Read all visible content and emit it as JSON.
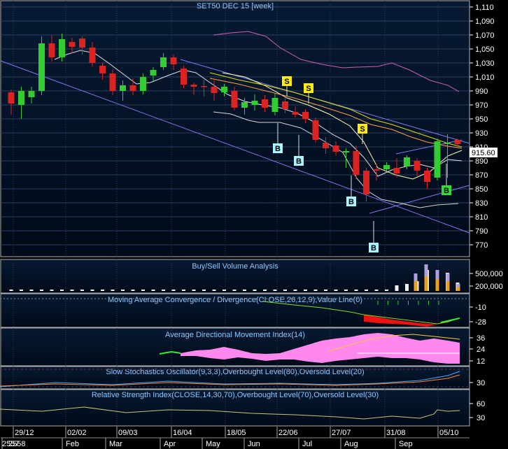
{
  "chart_data": [
    {
      "type": "candlestick",
      "title": "SET50 DEC 15   [week]",
      "y_ticks": [
        1110,
        1090,
        1070,
        1050,
        1030,
        1010,
        990,
        970,
        950,
        930,
        910,
        890,
        870,
        850,
        830,
        810,
        790,
        770
      ],
      "ylim": [
        758,
        1114
      ],
      "last_price": "915.60",
      "last_price_value": 915.6,
      "candles": [
        {
          "o": 988,
          "c": 972,
          "h": 992,
          "l": 956
        },
        {
          "o": 970,
          "c": 990,
          "h": 996,
          "l": 950
        },
        {
          "o": 981,
          "c": 990,
          "h": 996,
          "l": 972
        },
        {
          "o": 990,
          "c": 1058,
          "h": 1068,
          "l": 984
        },
        {
          "o": 1058,
          "c": 1038,
          "h": 1070,
          "l": 1032
        },
        {
          "o": 1038,
          "c": 1064,
          "h": 1072,
          "l": 1032
        },
        {
          "o": 1060,
          "c": 1053,
          "h": 1066,
          "l": 1044
        },
        {
          "o": 1065,
          "c": 1052,
          "h": 1068,
          "l": 1042
        },
        {
          "o": 1052,
          "c": 1030,
          "h": 1060,
          "l": 1025
        },
        {
          "o": 1026,
          "c": 1015,
          "h": 1030,
          "l": 1006
        },
        {
          "o": 1015,
          "c": 990,
          "h": 1020,
          "l": 984
        },
        {
          "o": 990,
          "c": 998,
          "h": 1005,
          "l": 976
        },
        {
          "o": 998,
          "c": 990,
          "h": 1008,
          "l": 984
        },
        {
          "o": 990,
          "c": 1010,
          "h": 1015,
          "l": 985
        },
        {
          "o": 1012,
          "c": 1020,
          "h": 1024,
          "l": 1004
        },
        {
          "o": 1024,
          "c": 1038,
          "h": 1044,
          "l": 1020
        },
        {
          "o": 1038,
          "c": 1028,
          "h": 1042,
          "l": 1020
        },
        {
          "o": 1022,
          "c": 999,
          "h": 1026,
          "l": 994
        },
        {
          "o": 999,
          "c": 996,
          "h": 1002,
          "l": 985
        },
        {
          "o": 997,
          "c": 996,
          "h": 1006,
          "l": 982
        },
        {
          "o": 996,
          "c": 987,
          "h": 1008,
          "l": 976
        },
        {
          "o": 988,
          "c": 996,
          "h": 1000,
          "l": 982
        },
        {
          "o": 990,
          "c": 966,
          "h": 996,
          "l": 962
        },
        {
          "o": 966,
          "c": 974,
          "h": 980,
          "l": 956
        },
        {
          "o": 970,
          "c": 976,
          "h": 985,
          "l": 962
        },
        {
          "o": 978,
          "c": 966,
          "h": 984,
          "l": 960
        },
        {
          "o": 960,
          "c": 980,
          "h": 986,
          "l": 955
        },
        {
          "o": 975,
          "c": 964,
          "h": 980,
          "l": 958
        },
        {
          "o": 960,
          "c": 956,
          "h": 968,
          "l": 952
        },
        {
          "o": 960,
          "c": 950,
          "h": 964,
          "l": 944
        },
        {
          "o": 948,
          "c": 920,
          "h": 952,
          "l": 916
        },
        {
          "o": 916,
          "c": 908,
          "h": 924,
          "l": 900
        },
        {
          "o": 912,
          "c": 903,
          "h": 918,
          "l": 898
        },
        {
          "o": 902,
          "c": 904,
          "h": 908,
          "l": 880
        },
        {
          "o": 904,
          "c": 870,
          "h": 912,
          "l": 864
        },
        {
          "o": 876,
          "c": 842,
          "h": 880,
          "l": 832
        },
        {
          "o": 878,
          "c": 876,
          "h": 886,
          "l": 862
        },
        {
          "o": 878,
          "c": 884,
          "h": 888,
          "l": 876
        },
        {
          "o": 880,
          "c": 872,
          "h": 894,
          "l": 866
        },
        {
          "o": 882,
          "c": 895,
          "h": 898,
          "l": 878
        },
        {
          "o": 890,
          "c": 876,
          "h": 894,
          "l": 868
        },
        {
          "o": 876,
          "c": 860,
          "h": 880,
          "l": 850
        },
        {
          "o": 866,
          "c": 918,
          "h": 922,
          "l": 862
        },
        {
          "o": 914,
          "c": 916,
          "h": 928,
          "l": 866
        },
        {
          "o": 920,
          "c": 914,
          "h": 922,
          "l": 910
        }
      ],
      "sell_signals": [
        "S",
        "S",
        "S"
      ],
      "buy_signals": [
        "B",
        "B",
        "B",
        "B",
        "B"
      ],
      "x_tick_labels": [
        "29/12",
        "02/02",
        "09/03",
        "16/04",
        "18/05",
        "22/06",
        "27/07",
        "31/08",
        "05/10"
      ],
      "month_labels": [
        "2558",
        "Feb",
        "Mar",
        "Apr",
        "May",
        "Jun",
        "Jul",
        "Aug",
        "Sep"
      ],
      "year_label_overlap": "2557"
    },
    {
      "type": "bar",
      "title": "Buy/Sell Volume Analysis",
      "y_ticks": [
        "500,000",
        "200,000"
      ],
      "colors": {
        "buy": "#e8a020",
        "sell": "#b0a0e0"
      }
    },
    {
      "type": "line",
      "title": "Moving Average Convergence / Divergence(CLOSE,26,12,9),Value Line(0)",
      "y_ticks": [
        "-10",
        "-28"
      ]
    },
    {
      "type": "area",
      "title": "Average Directional Movement Index(14)",
      "y_ticks": [
        "36",
        "24",
        "12"
      ],
      "y_tick_values": [
        36,
        24,
        12
      ]
    },
    {
      "type": "line",
      "title": "Slow Stochastics Oscillator(9,3,3),Overbought Level(80),Oversold Level(20)",
      "y_ticks": [
        "30"
      ]
    },
    {
      "type": "line",
      "title": "Relative Strength Index(CLOSE,14,30,70),Overbought Level(70),Oversold Level(30)",
      "y_ticks": [
        "60",
        "30"
      ]
    }
  ],
  "colors": {
    "up": "#33cc33",
    "down": "#dd2222",
    "text_axis": "#ffffff",
    "title": "#8ec8ff",
    "grid": "#2c3e60",
    "signal_s_bg": "#ffee00",
    "signal_b_bg": "#a8f4ff",
    "signal_b_active_bg": "#33dd33"
  }
}
